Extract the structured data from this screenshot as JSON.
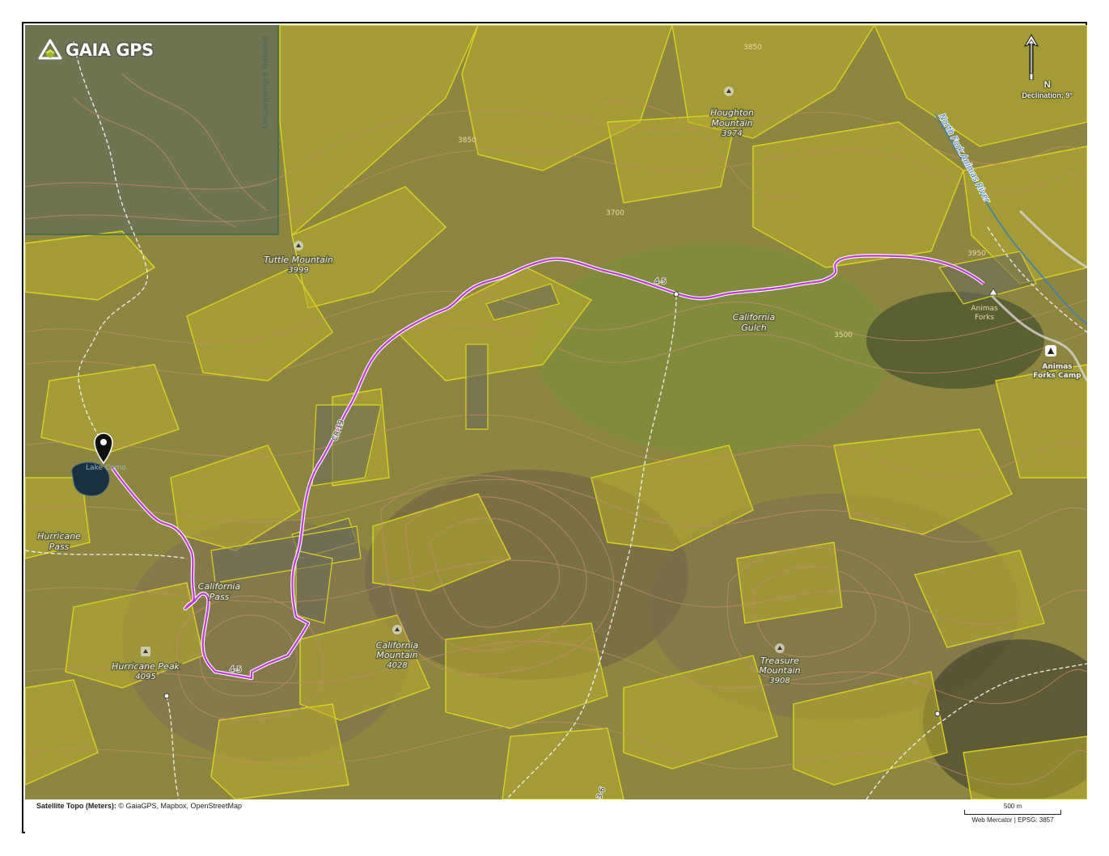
{
  "brand": {
    "name": "GAIA GPS",
    "icon": "gaia-mountain-logo-icon"
  },
  "north_arrow": {
    "letter": "N",
    "declination": "Declination: 9°",
    "icon": "north-arrow-icon"
  },
  "labels": {
    "tuttle_mountain": "Tuttle Mountain",
    "tuttle_elev": "3999",
    "houghton_mountain_1": "Houghton",
    "houghton_mountain_2": "Mountain",
    "houghton_elev": "3974",
    "california_gulch_1": "California",
    "california_gulch_2": "Gulch",
    "animas_forks_1": "Animas",
    "animas_forks_2": "Forks",
    "animas_camp_1": "Animas",
    "animas_camp_2": "Forks Camp",
    "lake_como": "Lake Como",
    "hurricane_pass_1": "Hurricane",
    "hurricane_pass_2": "Pass",
    "california_pass_1": "California",
    "california_pass_2": "Pass",
    "hurricane_peak": "Hurricane Peak",
    "hurricane_peak_elev": "4095",
    "california_mountain_1": "California",
    "california_mountain_2": "Mountain",
    "california_mountain_elev": "4028",
    "treasure_mountain_1": "Treasure",
    "treasure_mountain_2": "Mountain",
    "treasure_mountain_elev": "3908",
    "north_fork_river": "North Fork Animas River",
    "uncompahgre": "Uncompahgre National",
    "road_cr19": "CR-19",
    "road_45a": "4-5",
    "road_45b": "4-5",
    "road_36": "3-6",
    "contour_3850a": "3850",
    "contour_3850b": "3850",
    "contour_3700": "3700",
    "contour_3500": "3500",
    "contour_3950": "3950"
  },
  "route": {
    "color": "#c03ad8",
    "marker_icon": "map-pin-icon"
  },
  "colors": {
    "land_overlay": "#b7ad2e",
    "overlay_stroke": "#d8d020",
    "contour": "#c98a6a",
    "water": "#1c3140"
  },
  "footer": {
    "layer_name": "Satellite Topo (Meters):",
    "attribution": "© GaiaGPS, Mapbox, OpenStreetMap",
    "scale_label": "500 m",
    "projection": "Web Mercator | EPSG: 3857"
  }
}
